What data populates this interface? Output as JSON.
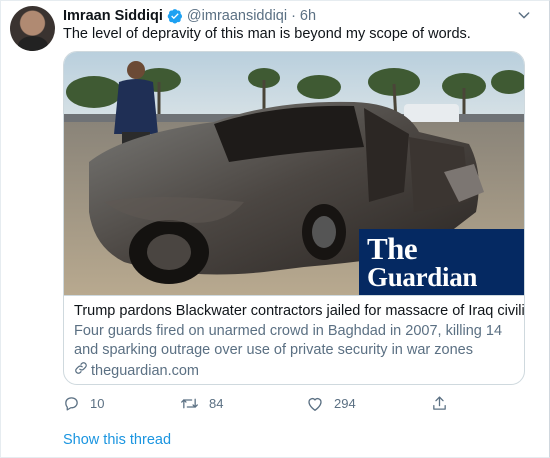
{
  "tweet": {
    "display_name": "Imraan Siddiqi",
    "handle": "@imraansiddiqi",
    "separator": "·",
    "time": "6h",
    "verified": true,
    "text": "The level of depravity of this man is beyond my scope of words."
  },
  "card": {
    "image_logo_line1": "The",
    "image_logo_line2": "Guardian",
    "title": "Trump pardons Blackwater contractors jailed for massacre of Iraq civilians",
    "description": "Four guards fired on unarmed crowd in Baghdad in 2007, killing 14 and sparking outrage over use of private security in war zones",
    "domain": "theguardian.com"
  },
  "actions": {
    "replies": "10",
    "retweets": "84",
    "likes": "294"
  },
  "thread_link": "Show this thread",
  "colors": {
    "accent": "#1b95e0",
    "muted": "#5b7083",
    "guardian_blue": "#052962"
  },
  "icons": [
    "verified-badge-icon",
    "caret-down-icon",
    "link-icon",
    "reply-icon",
    "retweet-icon",
    "like-icon",
    "share-icon"
  ]
}
